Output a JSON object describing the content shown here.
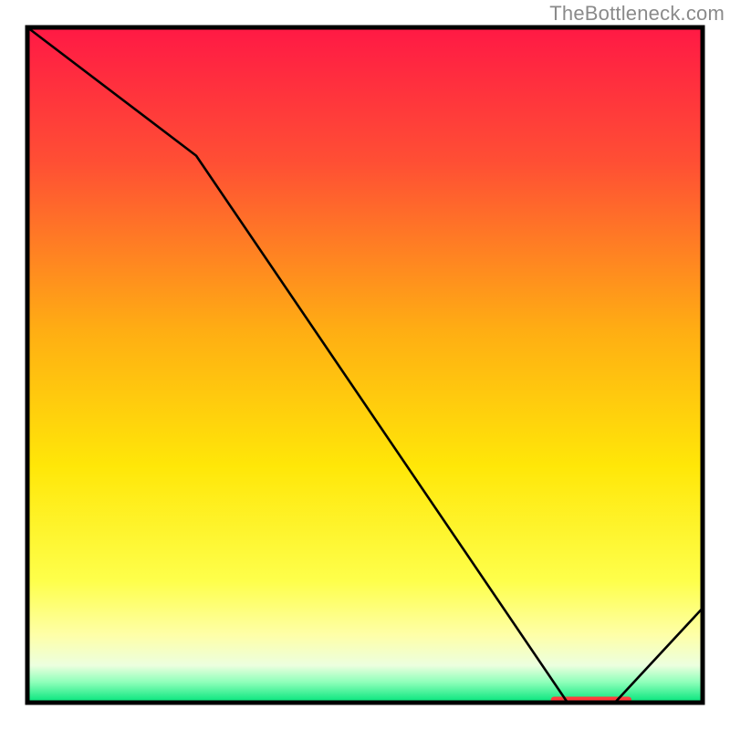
{
  "attribution": "TheBottleneck.com",
  "chart_data": {
    "type": "line",
    "title": "",
    "xlabel": "",
    "ylabel": "",
    "xlim": [
      0,
      100
    ],
    "ylim": [
      0,
      100
    ],
    "x": [
      0,
      25,
      80,
      87,
      100
    ],
    "values": [
      100,
      81,
      0,
      0,
      14
    ],
    "background_gradient_stops": [
      {
        "offset": 0.0,
        "color": "#ff1945"
      },
      {
        "offset": 0.2,
        "color": "#ff4f34"
      },
      {
        "offset": 0.45,
        "color": "#ffae13"
      },
      {
        "offset": 0.65,
        "color": "#ffe708"
      },
      {
        "offset": 0.82,
        "color": "#feff4b"
      },
      {
        "offset": 0.9,
        "color": "#feffa8"
      },
      {
        "offset": 0.945,
        "color": "#ecffdf"
      },
      {
        "offset": 0.97,
        "color": "#8dffb9"
      },
      {
        "offset": 1.0,
        "color": "#00e47a"
      }
    ],
    "optimal_marker": {
      "x_start": 78,
      "x_end": 89,
      "color": "#ff3b3b"
    }
  }
}
